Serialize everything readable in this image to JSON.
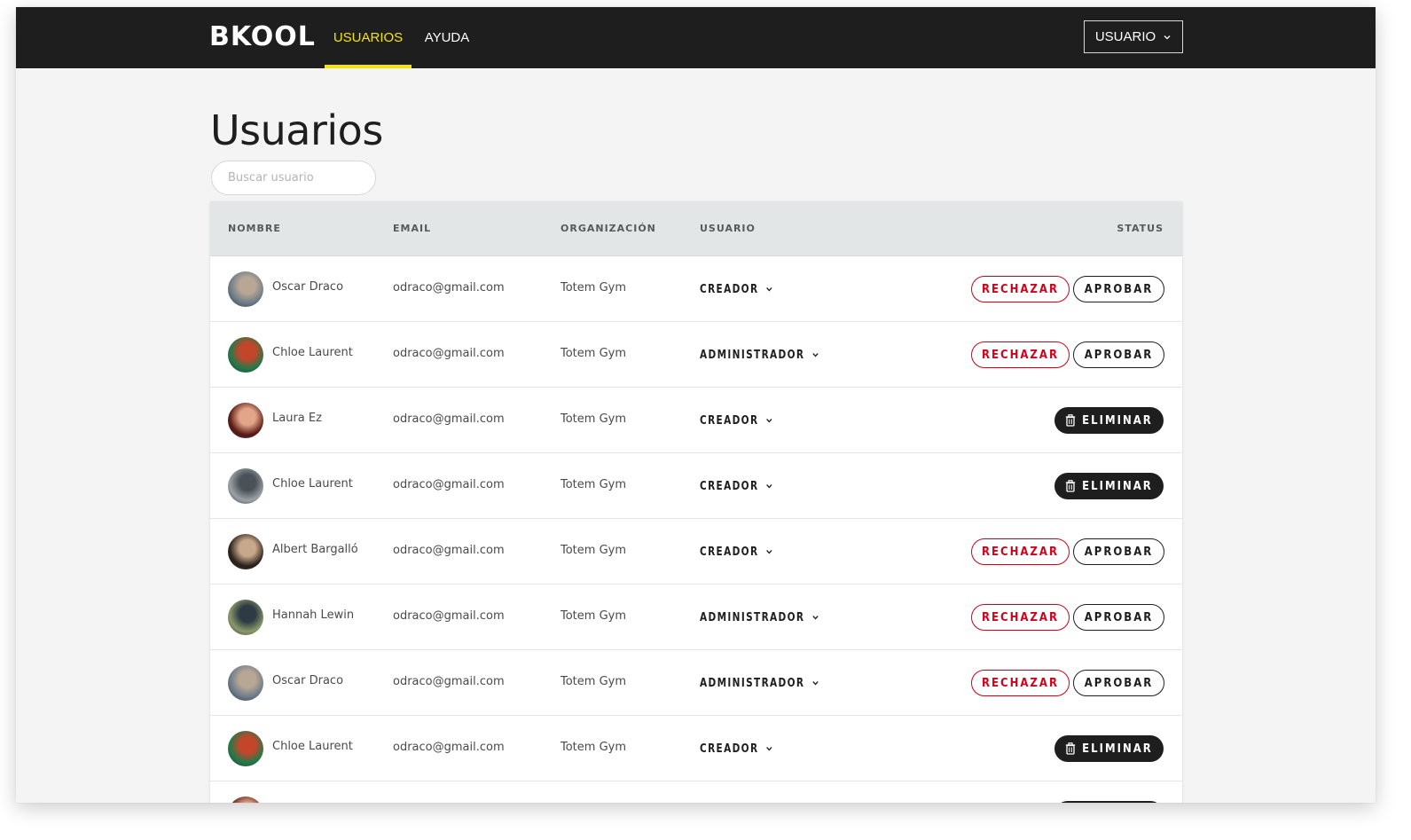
{
  "app": {
    "logo": "BKOOL",
    "nav": [
      {
        "label": "USUARIOS",
        "active": true
      },
      {
        "label": "AYUDA",
        "active": false
      }
    ],
    "user_menu": {
      "label": "USUARIO",
      "icon": "chevron-down-icon"
    },
    "accent_color": "#f5e600"
  },
  "page": {
    "title": "Usuarios",
    "search_placeholder": "Buscar usuario"
  },
  "table": {
    "headers": {
      "nombre": "NOMBRE",
      "email": "EMAIL",
      "organizacion": "ORGANIZACIÓN",
      "usuario": "USUARIO",
      "status": "STATUS"
    },
    "actions": {
      "reject": "RECHAZAR",
      "approve": "APROBAR",
      "delete": "ELIMINAR"
    },
    "rows": [
      {
        "name": "Oscar Draco",
        "email": "odraco@gmail.com",
        "org": "Totem Gym",
        "role": "CREADOR",
        "status": "pending",
        "avatar_colors": [
          "#6b7a88",
          "#b9a796"
        ]
      },
      {
        "name": "Chloe Laurent",
        "email": "odraco@gmail.com",
        "org": "Totem Gym",
        "role": "ADMINISTRADOR",
        "status": "pending",
        "avatar_colors": [
          "#1f7a4a",
          "#c4462a"
        ]
      },
      {
        "name": "Laura Ez",
        "email": "odraco@gmail.com",
        "org": "Totem Gym",
        "role": "CREADOR",
        "status": "approved",
        "avatar_colors": [
          "#5a1a14",
          "#e2a58a"
        ]
      },
      {
        "name": "Chloe Laurent",
        "email": "odraco@gmail.com",
        "org": "Totem Gym",
        "role": "CREADOR",
        "status": "approved",
        "avatar_colors": [
          "#9aa3a8",
          "#4b5257"
        ]
      },
      {
        "name": "Albert Bargalló",
        "email": "odraco@gmail.com",
        "org": "Totem Gym",
        "role": "CREADOR",
        "status": "pending",
        "avatar_colors": [
          "#2b221c",
          "#c8a88a"
        ]
      },
      {
        "name": "Hannah Lewin",
        "email": "odraco@gmail.com",
        "org": "Totem Gym",
        "role": "ADMINISTRADOR",
        "status": "pending",
        "avatar_colors": [
          "#8a9a6a",
          "#2e3a44"
        ]
      },
      {
        "name": "Oscar Draco",
        "email": "odraco@gmail.com",
        "org": "Totem Gym",
        "role": "ADMINISTRADOR",
        "status": "pending",
        "avatar_colors": [
          "#6b7a88",
          "#b9a796"
        ]
      },
      {
        "name": "Chloe Laurent",
        "email": "odraco@gmail.com",
        "org": "Totem Gym",
        "role": "CREADOR",
        "status": "approved",
        "avatar_colors": [
          "#1f7a4a",
          "#c4462a"
        ]
      }
    ],
    "partial_row_avatar_colors": [
      "#5a1a14",
      "#e2a58a"
    ]
  },
  "colors": {
    "navbar": "#1e1e1e",
    "reject": "#d0021b",
    "dark": "#1e1e1e"
  }
}
